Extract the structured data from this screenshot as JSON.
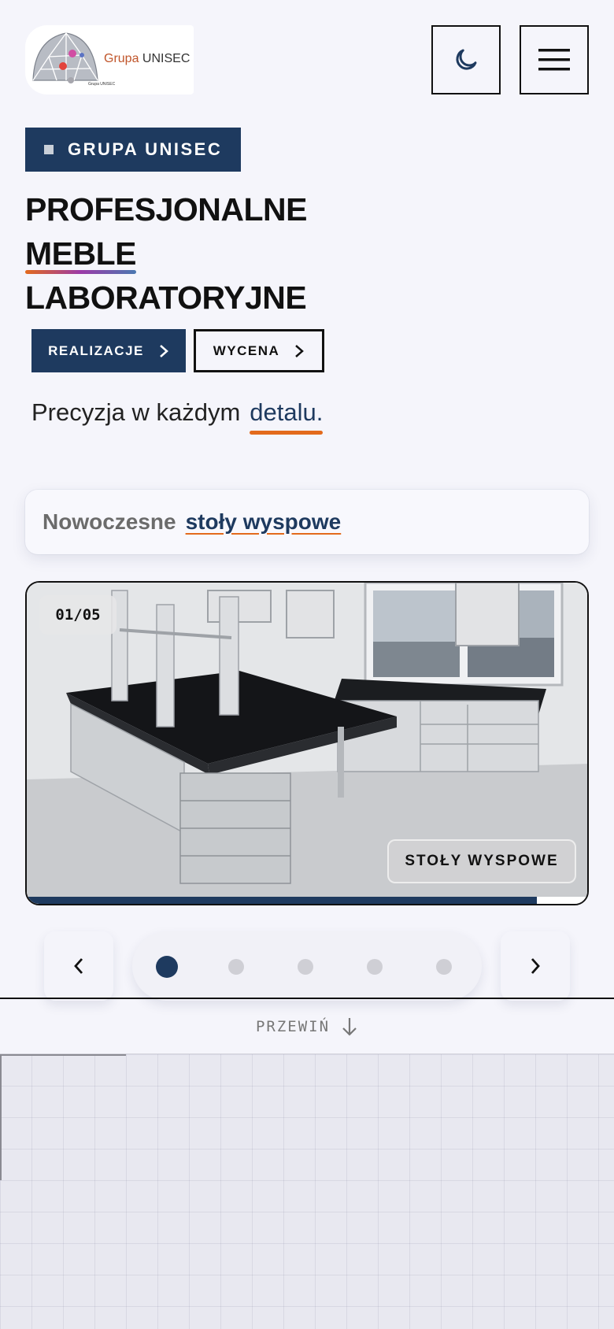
{
  "header": {
    "logo_brand_prefix": "Grupa",
    "logo_brand_name": "UNISEC",
    "logo_small_text": "Grupa UNISEC",
    "theme_icon": "moon-icon",
    "menu_icon": "hamburger-menu-icon"
  },
  "hero": {
    "badge": "GRUPA UNISEC",
    "title_line1": "PROFESJONALNE",
    "title_line2": "MEBLE",
    "title_line3": "LABORATORYJNE",
    "primary_button": "REALIZACJE",
    "secondary_button": "WYCENA",
    "tagline_prefix": "Precyzja w każdym",
    "tagline_accent": "detalu."
  },
  "feature": {
    "prefix": "Nowoczesne",
    "value": "stoły wyspowe"
  },
  "slider": {
    "counter": "01/05",
    "caption": "STOŁY WYSPOWE",
    "progress": 0.91,
    "total_slides": 5,
    "active_index": 0,
    "prev_icon": "chevron-left-icon",
    "next_icon": "chevron-right-icon"
  },
  "scroll_hint": {
    "label": "PRZEWIŃ",
    "icon": "arrow-down-icon"
  },
  "colors": {
    "primary": "#1e3a5f",
    "accent": "#e36a1c",
    "background": "#f5f5fb"
  }
}
